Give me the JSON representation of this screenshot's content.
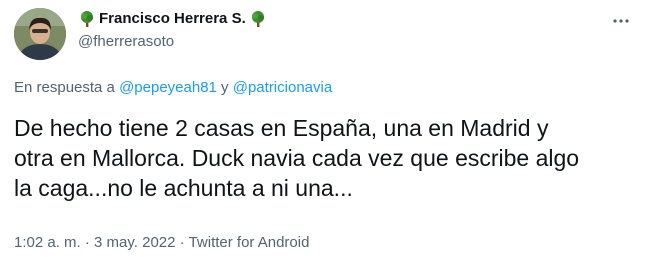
{
  "author": {
    "display_name": "Francisco Herrera S.",
    "handle": "@fherrerasoto",
    "name_emoji_left": "tree-icon",
    "name_emoji_right": "tree-icon"
  },
  "reply": {
    "prefix": "En respuesta a ",
    "mention1": "@pepeyeah81",
    "connector": " y ",
    "mention2": "@patricionavia"
  },
  "tweet": {
    "text": "De hecho tiene 2 casas en España, una en Madrid y\notra en Mallorca. Duck navia cada vez que escribe algo\nla caga...no le achunta a ni una..."
  },
  "meta": {
    "time": "1:02 a. m.",
    "sep1": " · ",
    "date": "3 may. 2022",
    "sep2": " · ",
    "source": "Twitter for Android"
  },
  "colors": {
    "link": "#1d9bf0",
    "secondary_text": "#536471",
    "primary_text": "#0f1419",
    "tree_green": "#3e8e2e"
  }
}
